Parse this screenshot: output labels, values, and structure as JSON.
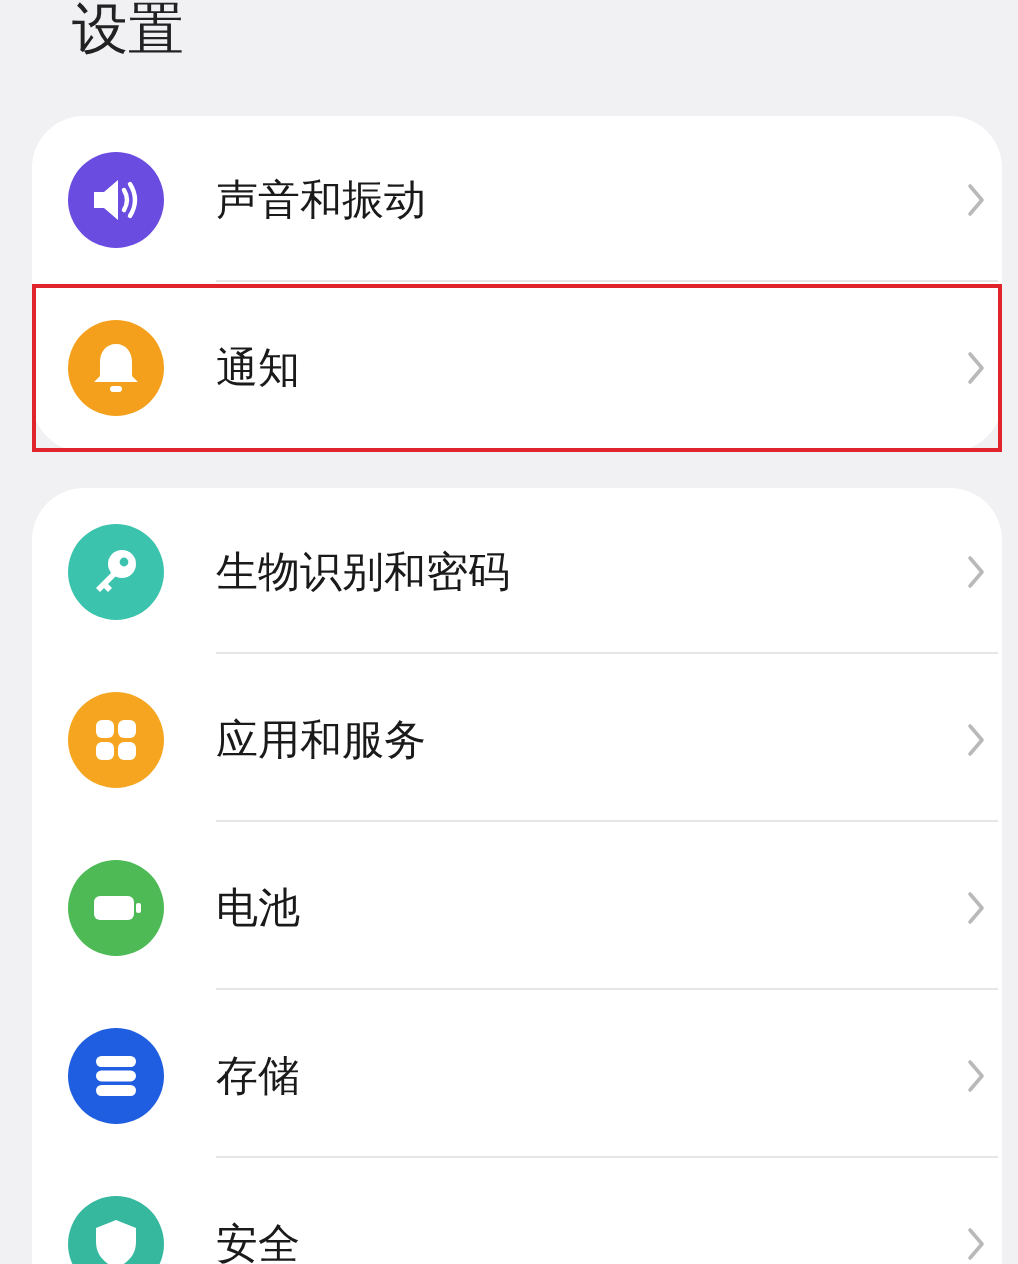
{
  "title": "设置",
  "groups": [
    {
      "items": [
        {
          "kind": "sound",
          "color": "#6a4de0",
          "label": "声音和振动",
          "highlighted": false
        },
        {
          "kind": "bell",
          "color": "#f5a01c",
          "label": "通知",
          "highlighted": true
        }
      ]
    },
    {
      "items": [
        {
          "kind": "key",
          "color": "#3cc3ae",
          "label": "生物识别和密码",
          "highlighted": false
        },
        {
          "kind": "apps",
          "color": "#f5a51f",
          "label": "应用和服务",
          "highlighted": false
        },
        {
          "kind": "battery",
          "color": "#4dba55",
          "label": "电池",
          "highlighted": false
        },
        {
          "kind": "storage",
          "color": "#1f5ee0",
          "label": "存储",
          "highlighted": false
        },
        {
          "kind": "shield",
          "color": "#35b89e",
          "label": "安全",
          "highlighted": false
        }
      ]
    }
  ]
}
